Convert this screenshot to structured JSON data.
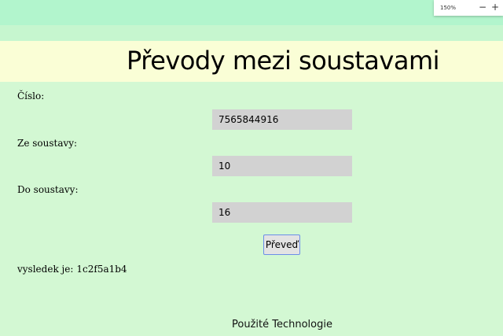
{
  "browser": {
    "zoom": "150%",
    "zoom_out": "−",
    "zoom_in": "+"
  },
  "page": {
    "title": "Převody mezi soustavami"
  },
  "form": {
    "number_label": "Číslo:",
    "number_value": "7565844916",
    "from_label": "Ze soustavy:",
    "from_value": "10",
    "to_label": "Do soustavy:",
    "to_value": "16",
    "submit_label": "Převeď"
  },
  "result": {
    "label": "vysledek je:",
    "value": "1c2f5a1b4"
  },
  "footer": {
    "title": "Použité Technologie"
  }
}
